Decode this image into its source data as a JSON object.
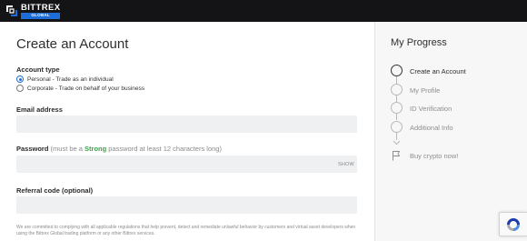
{
  "brand": {
    "name": "BITTREX",
    "sub": "GLOBAL"
  },
  "form": {
    "title": "Create an Account",
    "account_type": {
      "label": "Account type",
      "options": [
        {
          "label": "Personal - Trade as an individual",
          "selected": true
        },
        {
          "label": "Corporate - Trade on behalf of your business",
          "selected": false
        }
      ]
    },
    "email": {
      "label": "Email address",
      "value": "",
      "placeholder": ""
    },
    "password": {
      "label": "Password",
      "hint_prefix": "(must be a ",
      "hint_strong": "Strong",
      "hint_suffix": " password at least 12 characters long)",
      "value": "",
      "show_label": "SHOW"
    },
    "referral": {
      "label": "Referral code (optional)",
      "value": "",
      "placeholder": ""
    },
    "legal": "We are committed to complying with all applicable regulations that help prevent, detect and remediate unlawful behavior by customers and virtual asset developers when using the Bittrex Global trading platform or any other Bittrex services."
  },
  "progress": {
    "title": "My Progress",
    "steps": [
      {
        "label": "Create an Account",
        "current": true
      },
      {
        "label": "My Profile",
        "current": false
      },
      {
        "label": "ID Verification",
        "current": false
      },
      {
        "label": "Additional Info",
        "current": false
      }
    ],
    "final": {
      "label": "Buy crypto now!"
    }
  },
  "colors": {
    "accent": "#1d6dd8",
    "strong": "#3da24a",
    "topbar": "#141416"
  },
  "icons": {
    "logo": "bittrex-logo-icon",
    "flag": "flag-icon",
    "chevron": "chevron-down-icon",
    "captcha": "recaptcha-icon"
  }
}
